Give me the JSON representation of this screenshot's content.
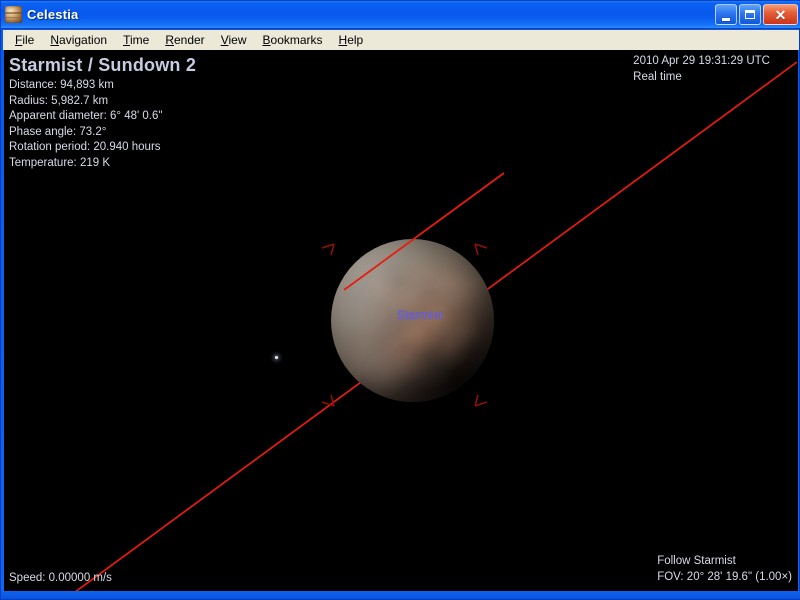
{
  "window": {
    "title": "Celestia",
    "icon": "planet-icon",
    "buttons": {
      "minimize": "minimize-button",
      "maximize": "maximize-button",
      "close": "close-button",
      "minimize_glyph": "_",
      "maximize_glyph": "□",
      "close_glyph": "✕"
    }
  },
  "menu": {
    "items": [
      {
        "label": "File",
        "accel": "F"
      },
      {
        "label": "Navigation",
        "accel": "N"
      },
      {
        "label": "Time",
        "accel": "T"
      },
      {
        "label": "Render",
        "accel": "R"
      },
      {
        "label": "View",
        "accel": "V"
      },
      {
        "label": "Bookmarks",
        "accel": "B"
      },
      {
        "label": "Help",
        "accel": "H"
      }
    ]
  },
  "info_panel": {
    "object_name": "Starmist / Sundown 2",
    "lines": [
      "Distance: 94,893 km",
      "Radius: 5,982.7 km",
      "Apparent diameter: 6° 48' 0.6\"",
      "Phase angle: 73.2°",
      "Rotation period: 20.940 hours",
      "Temperature: 219 K"
    ],
    "distance": "Distance: 94,893 km",
    "radius": "Radius: 5,982.7 km",
    "apparent_diameter": "Apparent diameter: 6° 48' 0.6\"",
    "phase_angle": "Phase angle: 73.2°",
    "rotation_period": "Rotation period: 20.940 hours",
    "temperature": "Temperature: 219 K"
  },
  "time_panel": {
    "datetime": "2010 Apr 29 19:31:29 UTC",
    "mode": "Real time"
  },
  "follow_panel": {
    "mode": "Follow Starmist",
    "fov": "FOV: 20° 28' 19.6\" (1.00×)"
  },
  "speed_panel": {
    "speed": "Speed: 0.00000 m/s"
  },
  "scene": {
    "planet_label": "Starmist",
    "planet_label_color": "#6a64e8",
    "orbit_line_color": "#e81c0c",
    "selection_marker_color": "#8c1208",
    "background_color": "#000000",
    "hud_text_color": "#d8dbe8",
    "title_bar_color": "#0858ee",
    "menu_bar_color": "#ece9d8"
  }
}
